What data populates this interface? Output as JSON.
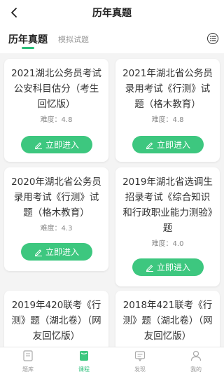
{
  "header": {
    "title": "历年真题"
  },
  "tabs": {
    "active": "历年真题",
    "other": "模拟试题"
  },
  "cards": [
    {
      "title": "2021湖北公务员考试公安科目估分（考生回忆版）",
      "difficulty": "难度：4.8",
      "button": "立即进入"
    },
    {
      "title": "2021年湖北省公务员录用考试《行测》试题（格木教育）",
      "difficulty": "难度：4.8",
      "button": "立即进入"
    },
    {
      "title": "2020年湖北省公务员录用考试《行测》试题（格木教育）",
      "difficulty": "难度：4.3",
      "button": "立即进入"
    },
    {
      "title": "2019年湖北省选调生招录考试《综合知识和行政职业能力测验》题",
      "difficulty": "难度：4.0",
      "button": "立即进入"
    },
    {
      "title": "2019年420联考《行测》题（湖北卷）（网友回忆版）",
      "difficulty": "",
      "button": ""
    },
    {
      "title": "2018年421联考《行测》题（湖北卷）（网友回忆版）",
      "difficulty": "",
      "button": ""
    }
  ],
  "bottom_nav": [
    {
      "label": "题库",
      "icon": "question-bank-icon"
    },
    {
      "label": "课程",
      "icon": "course-icon"
    },
    {
      "label": "发现",
      "icon": "discover-icon"
    },
    {
      "label": "我的",
      "icon": "profile-icon"
    }
  ],
  "colors": {
    "accent": "#3dc77f",
    "tab_indicator": "#2bbf7a"
  }
}
